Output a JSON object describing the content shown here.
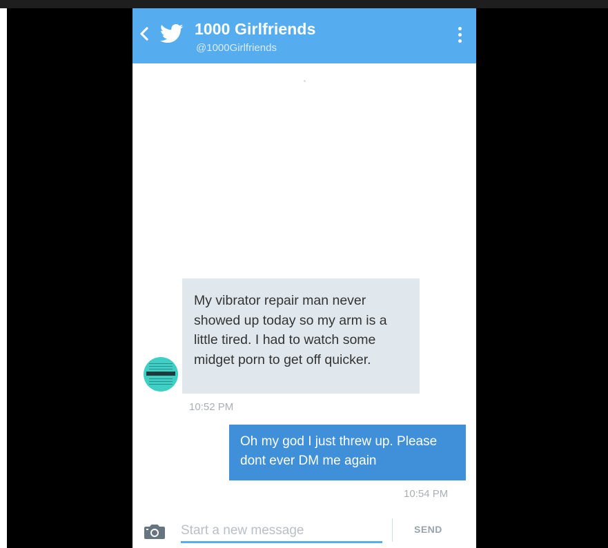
{
  "header": {
    "title": "1000 Girlfriends",
    "handle": "@1000Girlfriends",
    "color": "#55acee"
  },
  "icons": {
    "back": "chevron-left-icon",
    "brand": "twitter-bird-icon",
    "menu": "more-vertical-icon",
    "camera": "camera-icon"
  },
  "messages": [
    {
      "direction": "incoming",
      "text": "My vibrator repair man never showed up today so my arm is a little tired. I had to watch some midget porn to get off quicker.",
      "time": "10:52 PM"
    },
    {
      "direction": "outgoing",
      "text": "Oh my god I just threw up. Please dont ever DM me again",
      "time": "10:54 PM"
    }
  ],
  "composer": {
    "placeholder": "Start a new message",
    "value": "",
    "send_label": "SEND"
  },
  "colors": {
    "incoming_bubble": "#e1e8ed",
    "outgoing_bubble": "#3f8fd9",
    "timestamp": "#a8b0b5"
  }
}
